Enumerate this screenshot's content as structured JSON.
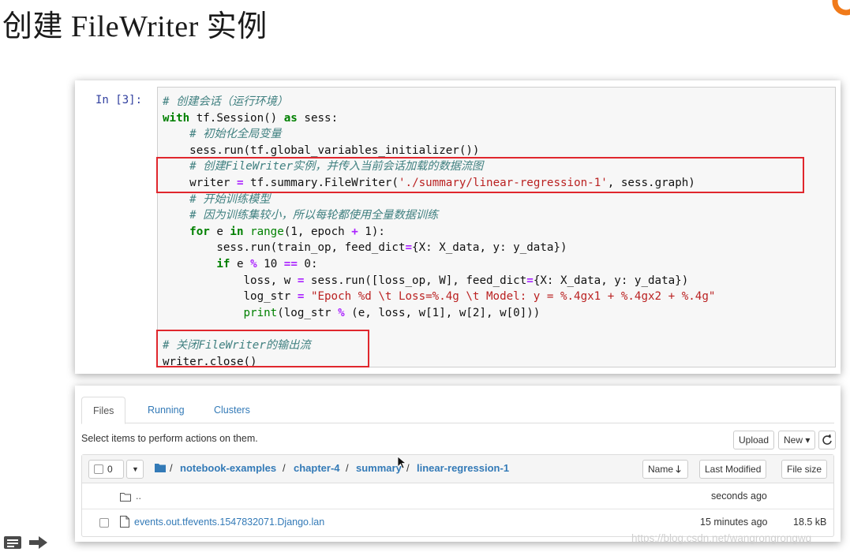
{
  "slide": {
    "title": "创建 FileWriter 实例"
  },
  "cell": {
    "prompt": "In [3]:",
    "lines": [
      [
        [
          "c",
          "# 创建会话（运行环境）"
        ]
      ],
      [
        [
          "k",
          "with"
        ],
        [
          "",
          " tf.Session() "
        ],
        [
          "k",
          "as"
        ],
        [
          "",
          " sess:"
        ]
      ],
      [
        [
          "",
          "    "
        ],
        [
          "c",
          "# 初始化全局变量"
        ]
      ],
      [
        [
          "",
          "    sess.run(tf.global_variables_initializer())"
        ]
      ],
      [
        [
          "",
          "    "
        ],
        [
          "c",
          "# 创建FileWriter实例，并传入当前会话加载的数据流图"
        ]
      ],
      [
        [
          "",
          "    writer "
        ],
        [
          "o",
          "="
        ],
        [
          "",
          " tf.summary.FileWriter("
        ],
        [
          "s",
          "'./summary/linear-regression-1'"
        ],
        [
          "",
          ", sess.graph)"
        ]
      ],
      [
        [
          "",
          "    "
        ],
        [
          "c",
          "# 开始训练模型"
        ]
      ],
      [
        [
          "",
          "    "
        ],
        [
          "c",
          "# 因为训练集较小，所以每轮都使用全量数据训练"
        ]
      ],
      [
        [
          "",
          "    "
        ],
        [
          "k",
          "for"
        ],
        [
          "",
          " e "
        ],
        [
          "k",
          "in"
        ],
        [
          "",
          " "
        ],
        [
          "n",
          "range"
        ],
        [
          "",
          "(1, epoch "
        ],
        [
          "o",
          "+"
        ],
        [
          "",
          " 1):"
        ]
      ],
      [
        [
          "",
          "        sess.run(train_op, feed_dict"
        ],
        [
          "o",
          "="
        ],
        [
          "",
          "{X: X_data, y: y_data})"
        ]
      ],
      [
        [
          "",
          "        "
        ],
        [
          "k",
          "if"
        ],
        [
          "",
          " e "
        ],
        [
          "o",
          "%"
        ],
        [
          "",
          " 10 "
        ],
        [
          "o",
          "=="
        ],
        [
          "",
          " 0:"
        ]
      ],
      [
        [
          "",
          "            loss, w "
        ],
        [
          "o",
          "="
        ],
        [
          "",
          " sess.run([loss_op, W], feed_dict"
        ],
        [
          "o",
          "="
        ],
        [
          "",
          "{X: X_data, y: y_data})"
        ]
      ],
      [
        [
          "",
          "            log_str "
        ],
        [
          "o",
          "="
        ],
        [
          "",
          " "
        ],
        [
          "s",
          "\"Epoch %d \\t Loss=%.4g \\t Model: y = %.4gx1 + %.4gx2 + %.4g\""
        ]
      ],
      [
        [
          "",
          "            "
        ],
        [
          "n",
          "print"
        ],
        [
          "",
          "(log_str "
        ],
        [
          "o",
          "%"
        ],
        [
          "",
          " (e, loss, w[1], w[2], w[0]))"
        ]
      ],
      [
        [
          "",
          ""
        ]
      ],
      [
        [
          "c",
          "# 关闭FileWriter的输出流"
        ]
      ],
      [
        [
          "",
          "writer.close()"
        ]
      ]
    ]
  },
  "browser": {
    "tabs": [
      "Files",
      "Running",
      "Clusters"
    ],
    "hint": "Select items to perform actions on them.",
    "upload_label": "Upload",
    "new_label": "New ▾",
    "refresh_icon": "refresh-icon",
    "selected_count": "0",
    "breadcrumb": [
      "notebook-examples",
      "chapter-4",
      "summary",
      "linear-regression-1"
    ],
    "sort_name_label": "Name",
    "sort_modified_label": "Last Modified",
    "sort_size_label": "File size",
    "parent_dir": {
      "name": "..",
      "modified": "seconds ago"
    },
    "files": [
      {
        "name": "events.out.tfevents.1547832071.Django.lan",
        "modified": "15 minutes ago",
        "size": "18.5 kB"
      }
    ]
  },
  "watermark": "https://blog.csdn.net/wangrongrongwq",
  "colors": {
    "highlight": "#e0272d",
    "link": "#337ab7",
    "prompt": "#303f9f"
  }
}
